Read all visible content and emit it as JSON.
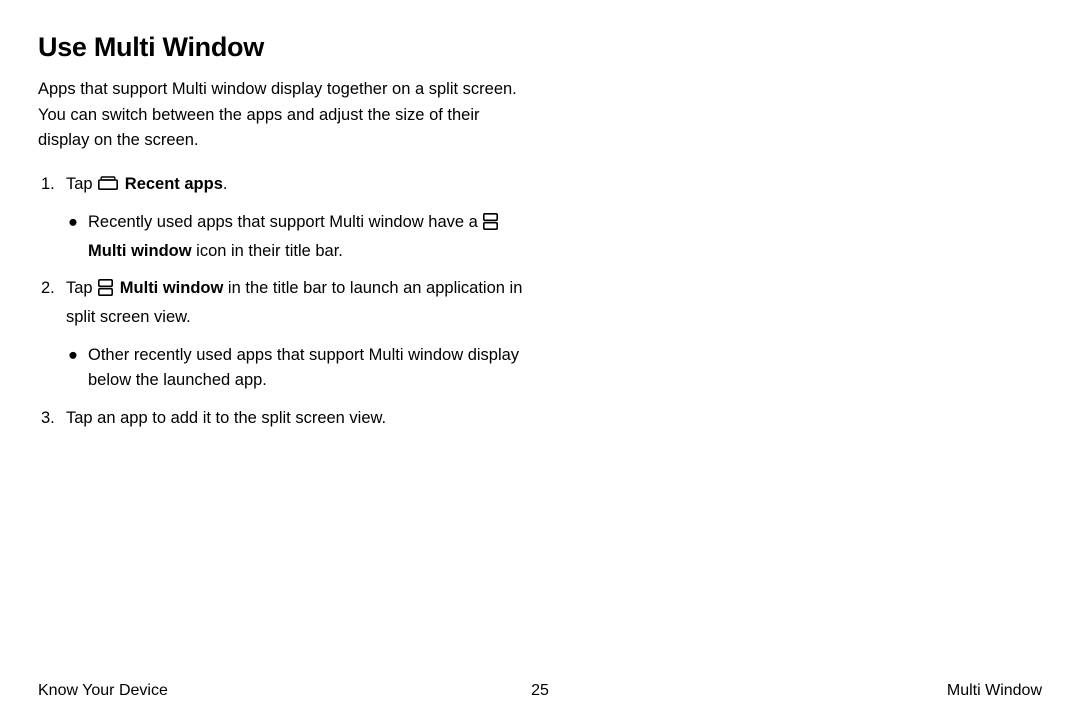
{
  "heading": "Use Multi Window",
  "intro": "Apps that support Multi window display together on a split screen. You can switch between the apps and adjust the size of their display on the screen.",
  "step1": {
    "num": "1.",
    "tap": "Tap ",
    "recent_apps": "Recent apps",
    "dot": "."
  },
  "step1_sub": {
    "bullet": "●",
    "a": "Recently used apps that support Multi window have a ",
    "multi": "Multi window",
    "b": " icon in their title bar."
  },
  "step2": {
    "num": "2.",
    "tap": "Tap ",
    "multi": "Multi window",
    "rest": " in the title bar to launch an application in split screen view."
  },
  "step2_sub": {
    "bullet": "●",
    "text": "Other recently used apps that support Multi window display below the launched app."
  },
  "step3": {
    "num": "3.",
    "text": "Tap an app to add it to the split screen view."
  },
  "footer": {
    "left": "Know Your Device",
    "center": "25",
    "right": "Multi Window"
  }
}
